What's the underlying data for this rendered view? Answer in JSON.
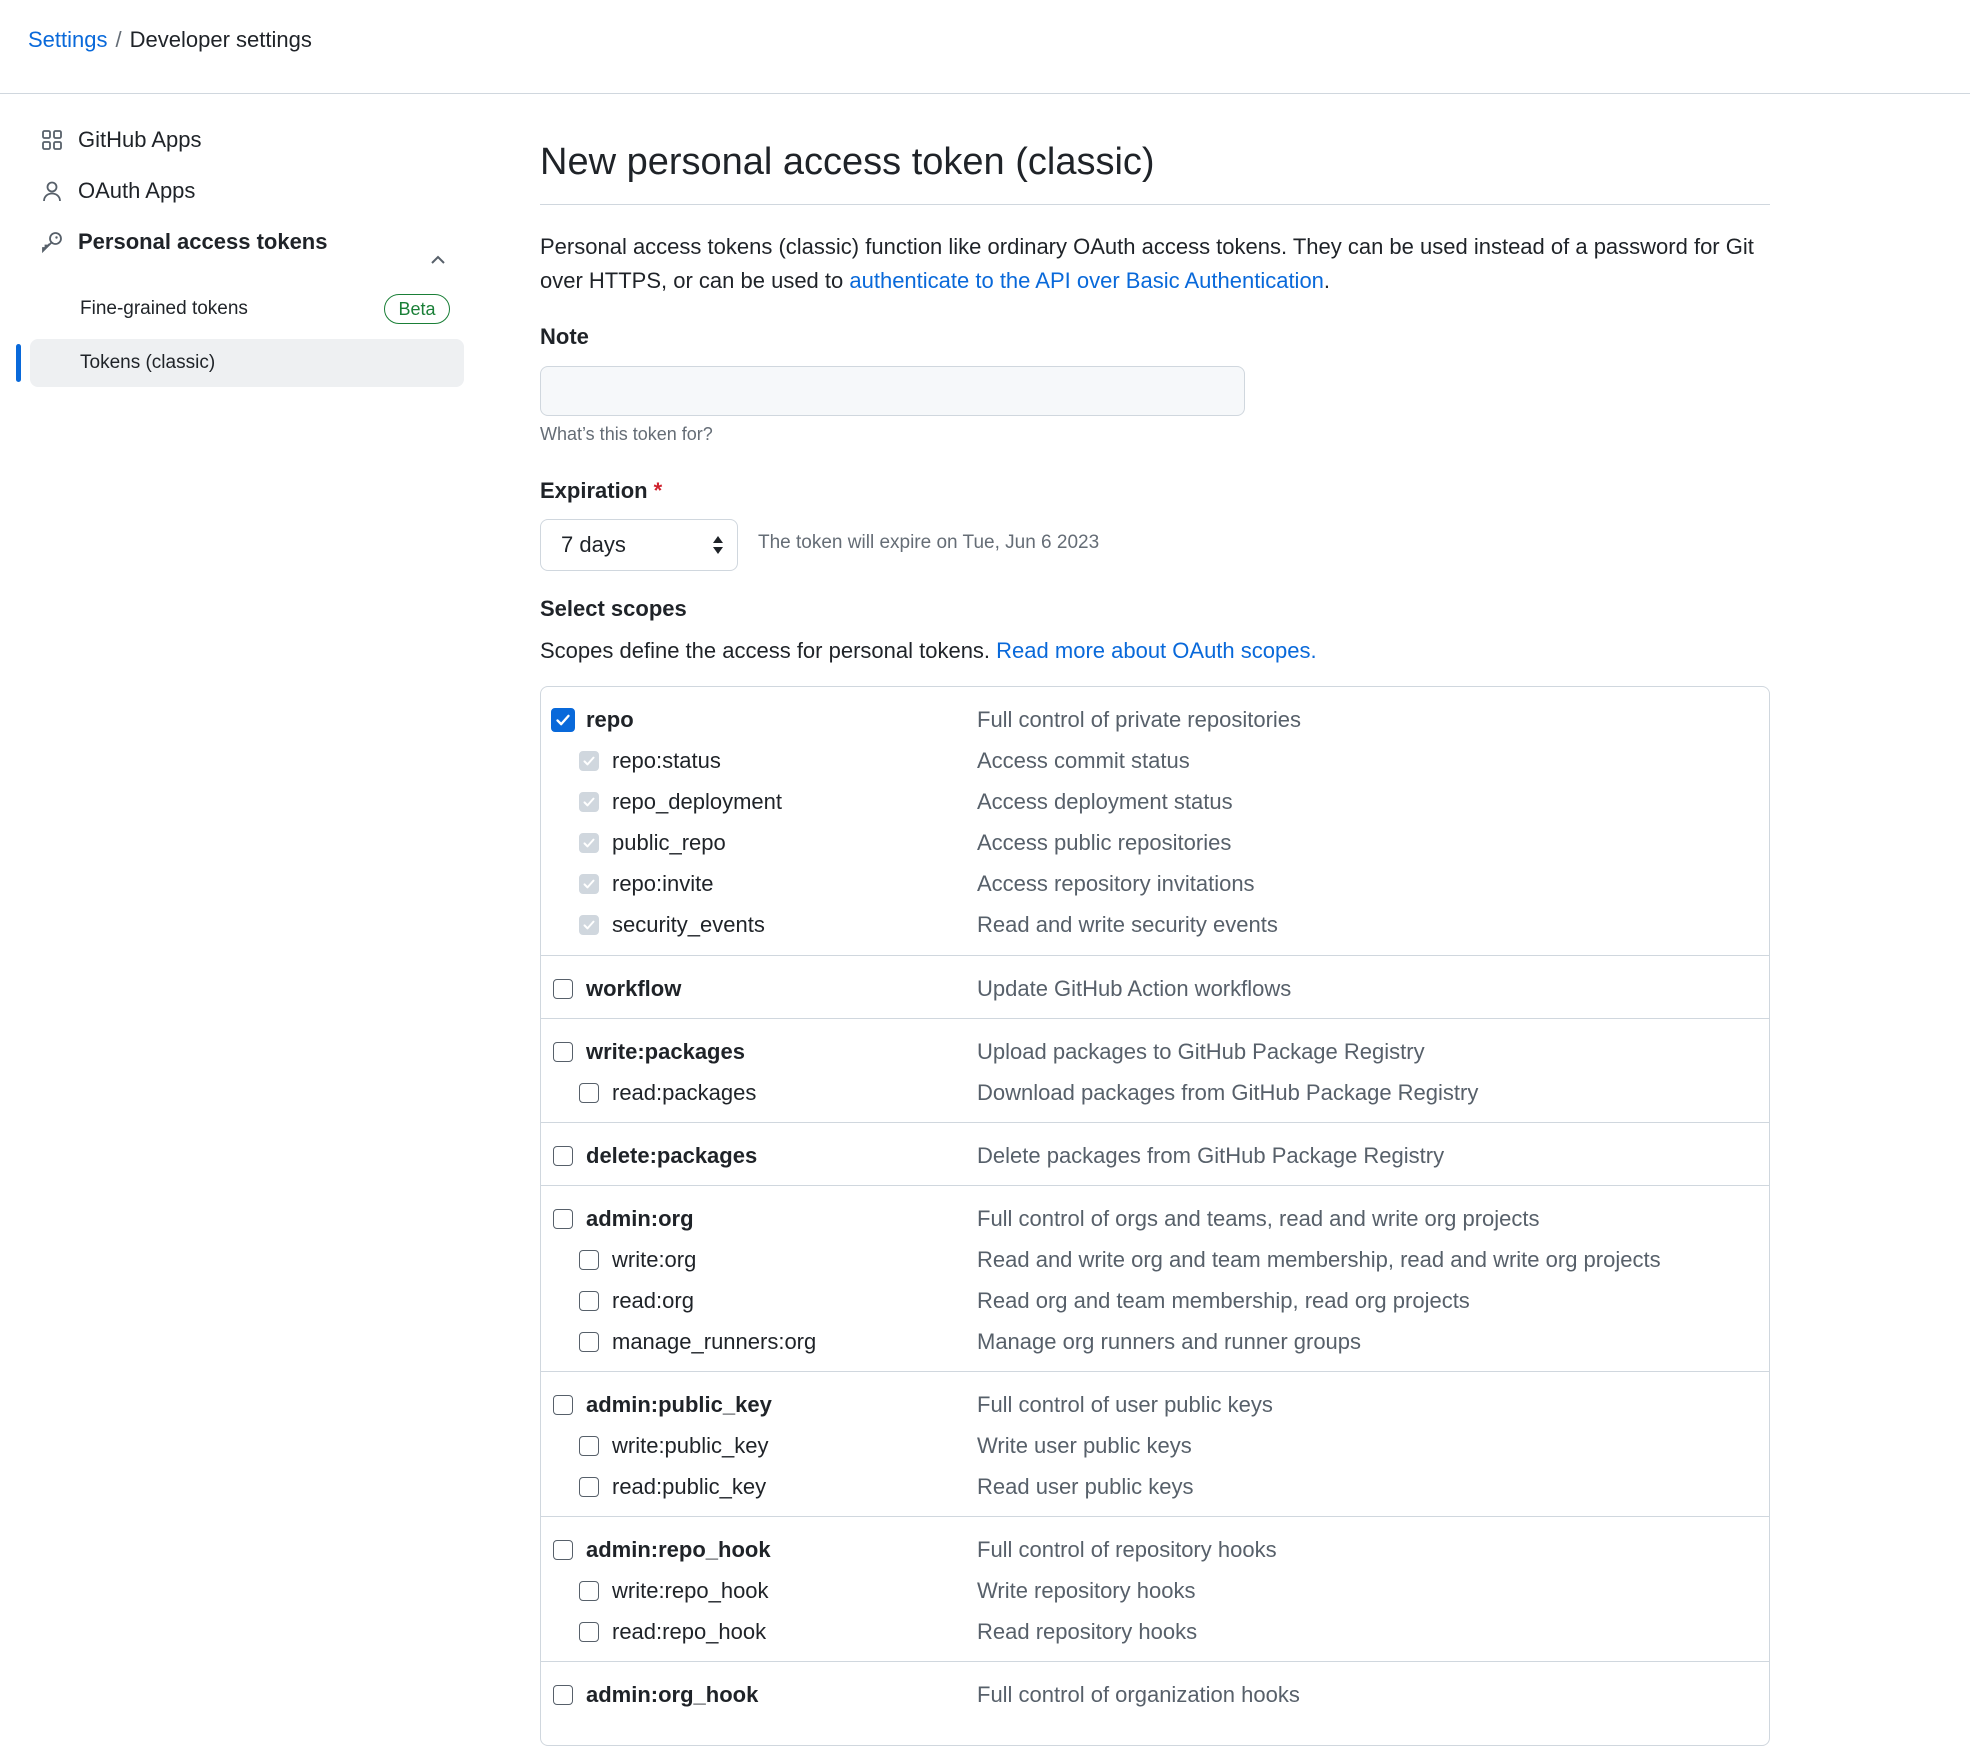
{
  "breadcrumb": {
    "root": "Settings",
    "separator": "/",
    "current": "Developer settings"
  },
  "sidebar": {
    "items": [
      {
        "label": "GitHub Apps",
        "icon": "apps-grid-icon"
      },
      {
        "label": "OAuth Apps",
        "icon": "person-icon"
      },
      {
        "label": "Personal access tokens",
        "icon": "key-icon",
        "expanded": true
      }
    ],
    "sub_items": [
      {
        "label": "Fine-grained tokens",
        "badge": "Beta"
      },
      {
        "label": "Tokens (classic)",
        "active": true
      }
    ]
  },
  "main": {
    "title": "New personal access token (classic)",
    "intro_text": "Personal access tokens (classic) function like ordinary OAuth access tokens. They can be used instead of a password for Git over HTTPS, or can be used to ",
    "intro_link": "authenticate to the API over Basic Authentication",
    "intro_end": ".",
    "note": {
      "label": "Note",
      "value": "",
      "placeholder": "",
      "hint": "What’s this token for?"
    },
    "expiration": {
      "label": "Expiration",
      "required_mark": "*",
      "selected": "7 days",
      "note": "The token will expire on Tue, Jun 6 2023"
    },
    "scopes": {
      "heading": "Select scopes",
      "description": "Scopes define the access for personal tokens.",
      "link": "Read more about OAuth scopes.",
      "groups": [
        {
          "name": "repo",
          "description": "Full control of private repositories",
          "checked": true,
          "children": [
            {
              "name": "repo:status",
              "description": "Access commit status"
            },
            {
              "name": "repo_deployment",
              "description": "Access deployment status"
            },
            {
              "name": "public_repo",
              "description": "Access public repositories"
            },
            {
              "name": "repo:invite",
              "description": "Access repository invitations"
            },
            {
              "name": "security_events",
              "description": "Read and write security events"
            }
          ]
        },
        {
          "name": "workflow",
          "description": "Update GitHub Action workflows",
          "checked": false,
          "children": []
        },
        {
          "name": "write:packages",
          "description": "Upload packages to GitHub Package Registry",
          "checked": false,
          "children": [
            {
              "name": "read:packages",
              "description": "Download packages from GitHub Package Registry"
            }
          ]
        },
        {
          "name": "delete:packages",
          "description": "Delete packages from GitHub Package Registry",
          "checked": false,
          "children": []
        },
        {
          "name": "admin:org",
          "description": "Full control of orgs and teams, read and write org projects",
          "checked": false,
          "children": [
            {
              "name": "write:org",
              "description": "Read and write org and team membership, read and write org projects"
            },
            {
              "name": "read:org",
              "description": "Read org and team membership, read org projects"
            },
            {
              "name": "manage_runners:org",
              "description": "Manage org runners and runner groups"
            }
          ]
        },
        {
          "name": "admin:public_key",
          "description": "Full control of user public keys",
          "checked": false,
          "children": [
            {
              "name": "write:public_key",
              "description": "Write user public keys"
            },
            {
              "name": "read:public_key",
              "description": "Read user public keys"
            }
          ]
        },
        {
          "name": "admin:repo_hook",
          "description": "Full control of repository hooks",
          "checked": false,
          "children": [
            {
              "name": "write:repo_hook",
              "description": "Write repository hooks"
            },
            {
              "name": "read:repo_hook",
              "description": "Read repository hooks"
            }
          ]
        },
        {
          "name": "admin:org_hook",
          "description": "Full control of organization hooks",
          "checked": false,
          "children": []
        }
      ]
    }
  },
  "colors": {
    "link": "#0969da",
    "accent_blue": "#0969da",
    "beta_green": "#1a7f37",
    "required_red": "#cf222e"
  }
}
